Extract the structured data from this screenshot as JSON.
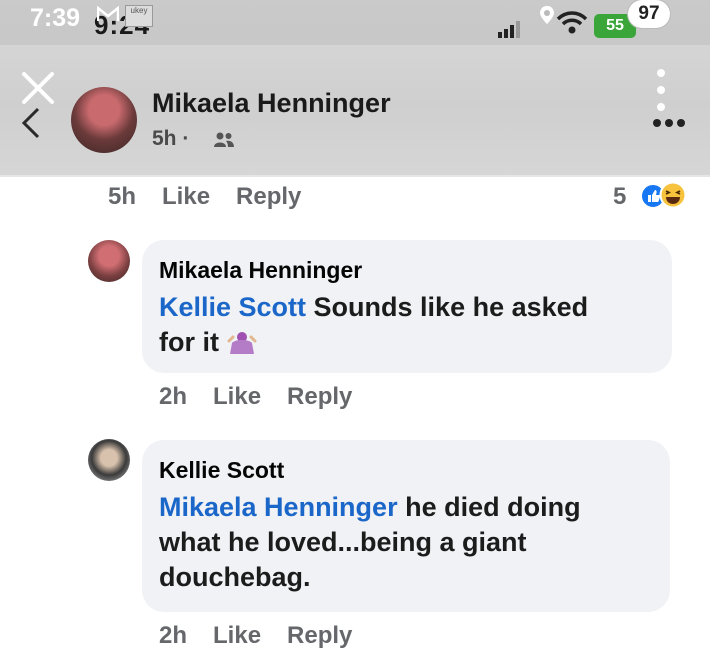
{
  "status_bar": {
    "time_overlay": "7:39",
    "time_underlying": "9:24",
    "thumbnail_label": "ukey",
    "battery": "55",
    "notification_badge": "97"
  },
  "post_header": {
    "name": "Mikaela Henninger",
    "meta": "5h ·"
  },
  "first_actions": {
    "time": "5h",
    "like": "Like",
    "reply": "Reply",
    "reaction_count": "5"
  },
  "comments": [
    {
      "author": "Mikaela Henninger",
      "mention": "Kellie Scott",
      "text_line1": " Sounds like he asked",
      "text_line2": "for it ",
      "time": "2h",
      "like": "Like",
      "reply": "Reply"
    },
    {
      "author": "Kellie Scott",
      "mention": "Mikaela Henninger",
      "text_line1": " he died doing",
      "text_line2": "what he loved...being a giant",
      "text_line3": "douchebag.",
      "time": "2h",
      "like": "Like",
      "reply": "Reply"
    }
  ],
  "colors": {
    "mention": "#1b67c9",
    "action_gray": "#65676b",
    "bubble": "#f0f2f5"
  },
  "icons": [
    "close-icon",
    "back-icon",
    "friends-icon",
    "more-vertical-icon",
    "more-horizontal-icon",
    "like-reaction-icon",
    "haha-reaction-icon",
    "shrug-emoji-icon",
    "wifi-icon",
    "signal-icon",
    "location-icon",
    "mail-icon"
  ]
}
